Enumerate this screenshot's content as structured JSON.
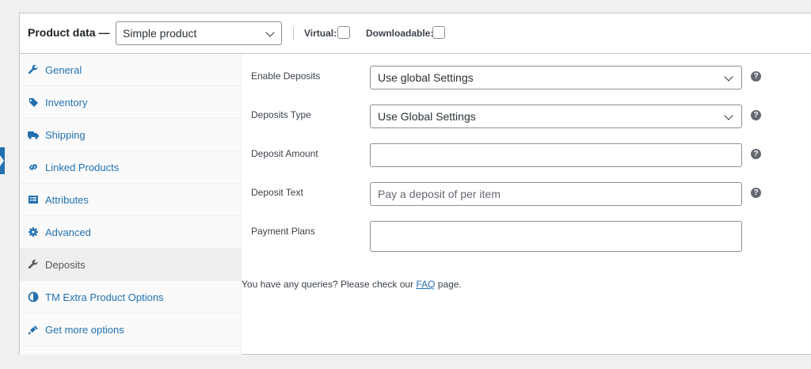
{
  "header": {
    "title": "Product data —",
    "product_type": {
      "selected": "Simple product"
    },
    "virtual_label": "Virtual:",
    "downloadable_label": "Downloadable:"
  },
  "tabs": [
    {
      "label": "General",
      "icon": "wrench-icon"
    },
    {
      "label": "Inventory",
      "icon": "tag-icon"
    },
    {
      "label": "Shipping",
      "icon": "truck-icon"
    },
    {
      "label": "Linked Products",
      "icon": "link-icon"
    },
    {
      "label": "Attributes",
      "icon": "list-icon"
    },
    {
      "label": "Advanced",
      "icon": "gear-icon"
    },
    {
      "label": "Deposits",
      "icon": "wrench-icon",
      "active": true
    },
    {
      "label": "TM Extra Product Options",
      "icon": "half-circle-icon"
    },
    {
      "label": "Get more options",
      "icon": "plugin-icon"
    }
  ],
  "fields": {
    "enable_deposits": {
      "label": "Enable Deposits",
      "value": "Use global Settings"
    },
    "deposits_type": {
      "label": "Deposits Type",
      "value": "Use Global Settings"
    },
    "deposit_amount": {
      "label": "Deposit Amount",
      "value": ""
    },
    "deposit_text": {
      "label": "Deposit Text",
      "placeholder": "Pay a deposit of per item"
    },
    "payment_plans": {
      "label": "Payment Plans",
      "value": ""
    }
  },
  "help_glyph": "?",
  "footer": {
    "text_before": "You have any queries? Please check our ",
    "link": "FAQ",
    "text_after": " page."
  },
  "colors": {
    "link": "#2271b1",
    "active_tab_bg": "#eeeeee"
  }
}
